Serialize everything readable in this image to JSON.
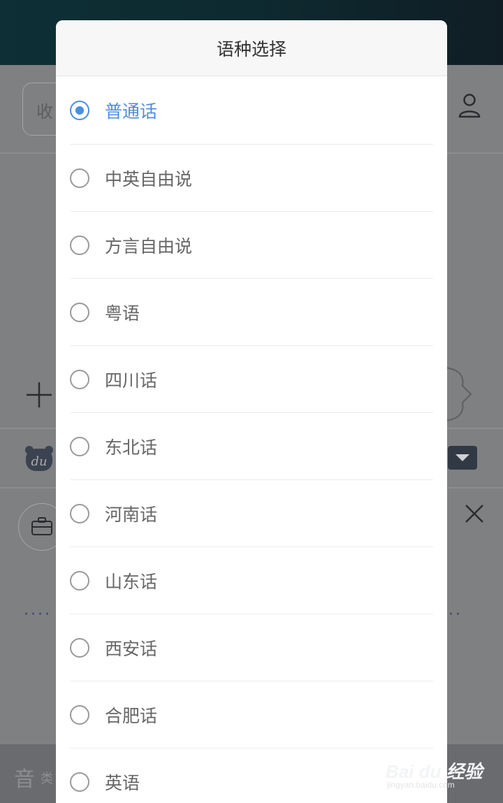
{
  "background": {
    "search_placeholder": "收",
    "bottom_text": "音",
    "bottom_small": "类",
    "icons": [
      "user-icon",
      "plus-icon",
      "du-logo-icon",
      "dropdown-icon",
      "briefcase-icon",
      "close-icon"
    ]
  },
  "dialog": {
    "title": "语种选择",
    "options": [
      {
        "label": "普通话",
        "selected": true
      },
      {
        "label": "中英自由说",
        "selected": false
      },
      {
        "label": "方言自由说",
        "selected": false
      },
      {
        "label": "粤语",
        "selected": false
      },
      {
        "label": "四川话",
        "selected": false
      },
      {
        "label": "东北话",
        "selected": false
      },
      {
        "label": "河南话",
        "selected": false
      },
      {
        "label": "山东话",
        "selected": false
      },
      {
        "label": "西安话",
        "selected": false
      },
      {
        "label": "合肥话",
        "selected": false
      },
      {
        "label": "英语",
        "selected": false
      }
    ]
  },
  "watermark": {
    "main": "Bai du 经验",
    "sub": "jingyan.baidu.com"
  },
  "colors": {
    "accent": "#4a8fe0",
    "overlay": "#7f8082"
  }
}
